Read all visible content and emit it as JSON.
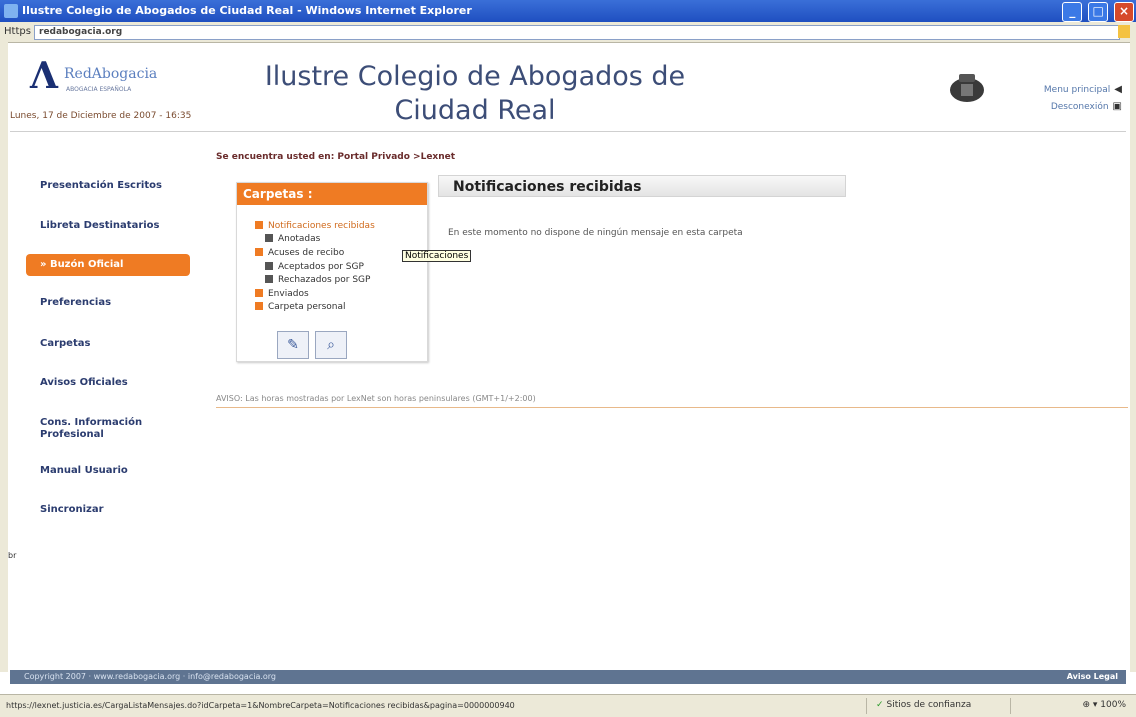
{
  "window": {
    "title": "Ilustre Colegio de Abogados de Ciudad Real - Windows Internet Explorer",
    "address_label": "Https",
    "address_host": "redabogacia.org",
    "buttons": {
      "minimize": "_",
      "maximize": "□",
      "close": "×"
    }
  },
  "header": {
    "logo_mark": "Λ",
    "logo_name": "RedAbogacia",
    "logo_sub": "ABOGACIA ESPAÑOLA",
    "date": "Lunes, 17 de Diciembre de 2007 - 16:35",
    "title": "Ilustre Colegio de Abogados de Ciudad Real",
    "links": [
      {
        "label": "Menu principal",
        "icon": "arrow-left-icon",
        "glyph": "◀"
      },
      {
        "label": "Desconexión",
        "icon": "logout-icon",
        "glyph": "▣"
      }
    ]
  },
  "sidebar": {
    "items": [
      {
        "label": "Presentación Escritos",
        "active": false
      },
      {
        "label": "Libreta Destinatarios",
        "active": false
      },
      {
        "label": "» Buzón Oficial",
        "active": true
      },
      {
        "label": "Preferencias",
        "active": false
      },
      {
        "label": "Carpetas",
        "active": false
      },
      {
        "label": "Avisos Oficiales",
        "active": false
      },
      {
        "label": "Cons. Información Profesional",
        "active": false
      },
      {
        "label": "Manual Usuario",
        "active": false
      },
      {
        "label": "Sincronizar",
        "active": false
      }
    ]
  },
  "breadcrumb": "Se encuentra usted en: Portal Privado >Lexnet",
  "folders": {
    "title": "Carpetas :",
    "tree": [
      {
        "label": "Notificaciones recibidas",
        "color": "#ef7b23",
        "level": 0,
        "selected": true
      },
      {
        "label": "Anotadas",
        "color": "#555555",
        "level": 1,
        "selected": false
      },
      {
        "label": "Acuses de recibo",
        "color": "#ef7b23",
        "level": 0,
        "selected": false
      },
      {
        "label": "Aceptados por SGP",
        "color": "#555555",
        "level": 1,
        "selected": false
      },
      {
        "label": "Rechazados por SGP",
        "color": "#555555",
        "level": 1,
        "selected": false
      },
      {
        "label": "Enviados",
        "color": "#ef7b23",
        "level": 0,
        "selected": false
      },
      {
        "label": "Carpeta personal",
        "color": "#ef7b23",
        "level": 0,
        "selected": false
      }
    ],
    "tools": [
      {
        "icon": "edit-icon",
        "glyph": "✎"
      },
      {
        "icon": "search-icon",
        "glyph": "⌕"
      }
    ]
  },
  "tooltip": "Notificaciones",
  "panel": {
    "title": "Notificaciones recibidas",
    "empty_message": "En este momento no dispone de ningún mensaje en esta carpeta"
  },
  "footer_note": "AVISO: Las horas mostradas por LexNet son horas peninsulares (GMT+1/+2:00)",
  "side_marker": "br",
  "bottom_bar": {
    "copyright": "Copyright 2007 · www.redabogacia.org · info@redabogacia.org",
    "legal": "Aviso Legal"
  },
  "statusbar": {
    "url": "https://lexnet.justicia.es/CargaListaMensajes.do?idCarpeta=1&NombreCarpeta=Notificaciones recibidas&pagina=0000000940",
    "zone": "Sitios de confianza",
    "zoom": "100%",
    "zoom_prefix": "⊕ ▾"
  },
  "colors": {
    "accent": "#ef7b23",
    "nav_text": "#2b3c6f",
    "title_text": "#3c4d77",
    "bottom_bar": "#5f7491"
  }
}
